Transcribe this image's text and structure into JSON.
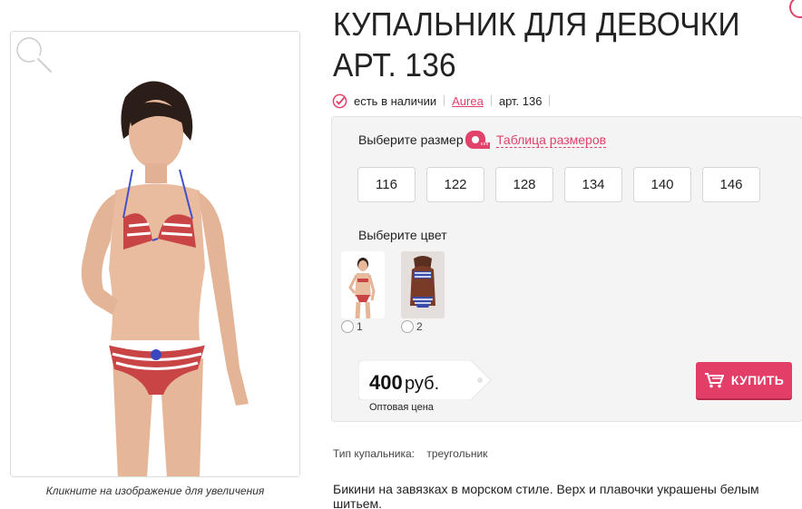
{
  "product": {
    "title": "КУПАЛЬНИК ДЛЯ ДЕВОЧКИ АРТ. 136",
    "availability": "есть в наличии",
    "brand": "Aurea",
    "article": "арт. 136"
  },
  "image": {
    "caption": "Кликните на изображение для увеличения"
  },
  "options": {
    "size_label": "Выберите размер",
    "size_table_link": "Таблица размеров",
    "sizes": [
      "116",
      "122",
      "128",
      "134",
      "140",
      "146"
    ],
    "color_label": "Выберите цвет",
    "colors": [
      {
        "label": "1"
      },
      {
        "label": "2"
      }
    ]
  },
  "price": {
    "value": "400",
    "currency": "руб.",
    "note": "Оптовая цена"
  },
  "buy_button": {
    "label": "КУПИТЬ"
  },
  "specs": {
    "type_label": "Тип купальника:",
    "type_value": "треугольник"
  },
  "description": "Бикини на завязках в морском стиле. Верх и плавочки украшены белым шитьем.",
  "colors": {
    "accent": "#e0426a",
    "button": "#e23e68",
    "panel": "#f4f4f4"
  }
}
